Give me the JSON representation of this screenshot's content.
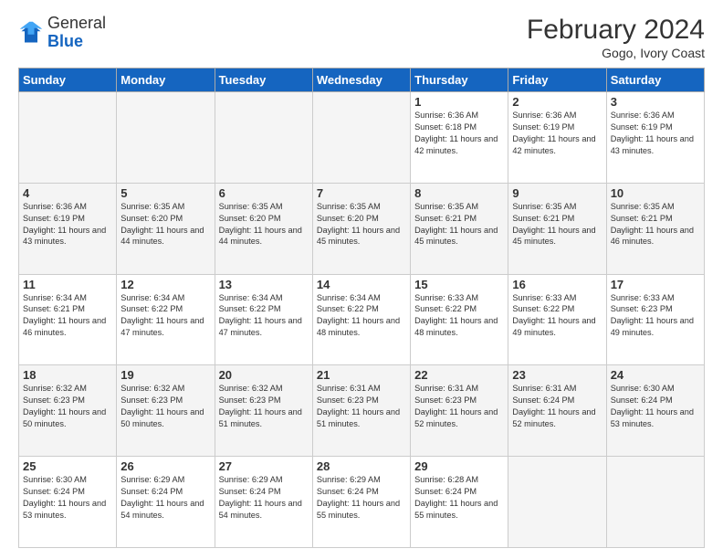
{
  "header": {
    "logo_line1": "General",
    "logo_line2": "Blue",
    "month_year": "February 2024",
    "location": "Gogo, Ivory Coast"
  },
  "days_of_week": [
    "Sunday",
    "Monday",
    "Tuesday",
    "Wednesday",
    "Thursday",
    "Friday",
    "Saturday"
  ],
  "weeks": [
    [
      {
        "day": "",
        "empty": true
      },
      {
        "day": "",
        "empty": true
      },
      {
        "day": "",
        "empty": true
      },
      {
        "day": "",
        "empty": true
      },
      {
        "day": "1",
        "sunrise": "6:36 AM",
        "sunset": "6:18 PM",
        "daylight": "11 hours and 42 minutes."
      },
      {
        "day": "2",
        "sunrise": "6:36 AM",
        "sunset": "6:19 PM",
        "daylight": "11 hours and 42 minutes."
      },
      {
        "day": "3",
        "sunrise": "6:36 AM",
        "sunset": "6:19 PM",
        "daylight": "11 hours and 43 minutes."
      }
    ],
    [
      {
        "day": "4",
        "sunrise": "6:36 AM",
        "sunset": "6:19 PM",
        "daylight": "11 hours and 43 minutes."
      },
      {
        "day": "5",
        "sunrise": "6:35 AM",
        "sunset": "6:20 PM",
        "daylight": "11 hours and 44 minutes."
      },
      {
        "day": "6",
        "sunrise": "6:35 AM",
        "sunset": "6:20 PM",
        "daylight": "11 hours and 44 minutes."
      },
      {
        "day": "7",
        "sunrise": "6:35 AM",
        "sunset": "6:20 PM",
        "daylight": "11 hours and 45 minutes."
      },
      {
        "day": "8",
        "sunrise": "6:35 AM",
        "sunset": "6:21 PM",
        "daylight": "11 hours and 45 minutes."
      },
      {
        "day": "9",
        "sunrise": "6:35 AM",
        "sunset": "6:21 PM",
        "daylight": "11 hours and 45 minutes."
      },
      {
        "day": "10",
        "sunrise": "6:35 AM",
        "sunset": "6:21 PM",
        "daylight": "11 hours and 46 minutes."
      }
    ],
    [
      {
        "day": "11",
        "sunrise": "6:34 AM",
        "sunset": "6:21 PM",
        "daylight": "11 hours and 46 minutes."
      },
      {
        "day": "12",
        "sunrise": "6:34 AM",
        "sunset": "6:22 PM",
        "daylight": "11 hours and 47 minutes."
      },
      {
        "day": "13",
        "sunrise": "6:34 AM",
        "sunset": "6:22 PM",
        "daylight": "11 hours and 47 minutes."
      },
      {
        "day": "14",
        "sunrise": "6:34 AM",
        "sunset": "6:22 PM",
        "daylight": "11 hours and 48 minutes."
      },
      {
        "day": "15",
        "sunrise": "6:33 AM",
        "sunset": "6:22 PM",
        "daylight": "11 hours and 48 minutes."
      },
      {
        "day": "16",
        "sunrise": "6:33 AM",
        "sunset": "6:22 PM",
        "daylight": "11 hours and 49 minutes."
      },
      {
        "day": "17",
        "sunrise": "6:33 AM",
        "sunset": "6:23 PM",
        "daylight": "11 hours and 49 minutes."
      }
    ],
    [
      {
        "day": "18",
        "sunrise": "6:32 AM",
        "sunset": "6:23 PM",
        "daylight": "11 hours and 50 minutes."
      },
      {
        "day": "19",
        "sunrise": "6:32 AM",
        "sunset": "6:23 PM",
        "daylight": "11 hours and 50 minutes."
      },
      {
        "day": "20",
        "sunrise": "6:32 AM",
        "sunset": "6:23 PM",
        "daylight": "11 hours and 51 minutes."
      },
      {
        "day": "21",
        "sunrise": "6:31 AM",
        "sunset": "6:23 PM",
        "daylight": "11 hours and 51 minutes."
      },
      {
        "day": "22",
        "sunrise": "6:31 AM",
        "sunset": "6:23 PM",
        "daylight": "11 hours and 52 minutes."
      },
      {
        "day": "23",
        "sunrise": "6:31 AM",
        "sunset": "6:24 PM",
        "daylight": "11 hours and 52 minutes."
      },
      {
        "day": "24",
        "sunrise": "6:30 AM",
        "sunset": "6:24 PM",
        "daylight": "11 hours and 53 minutes."
      }
    ],
    [
      {
        "day": "25",
        "sunrise": "6:30 AM",
        "sunset": "6:24 PM",
        "daylight": "11 hours and 53 minutes."
      },
      {
        "day": "26",
        "sunrise": "6:29 AM",
        "sunset": "6:24 PM",
        "daylight": "11 hours and 54 minutes."
      },
      {
        "day": "27",
        "sunrise": "6:29 AM",
        "sunset": "6:24 PM",
        "daylight": "11 hours and 54 minutes."
      },
      {
        "day": "28",
        "sunrise": "6:29 AM",
        "sunset": "6:24 PM",
        "daylight": "11 hours and 55 minutes."
      },
      {
        "day": "29",
        "sunrise": "6:28 AM",
        "sunset": "6:24 PM",
        "daylight": "11 hours and 55 minutes."
      },
      {
        "day": "",
        "empty": true
      },
      {
        "day": "",
        "empty": true
      }
    ]
  ]
}
